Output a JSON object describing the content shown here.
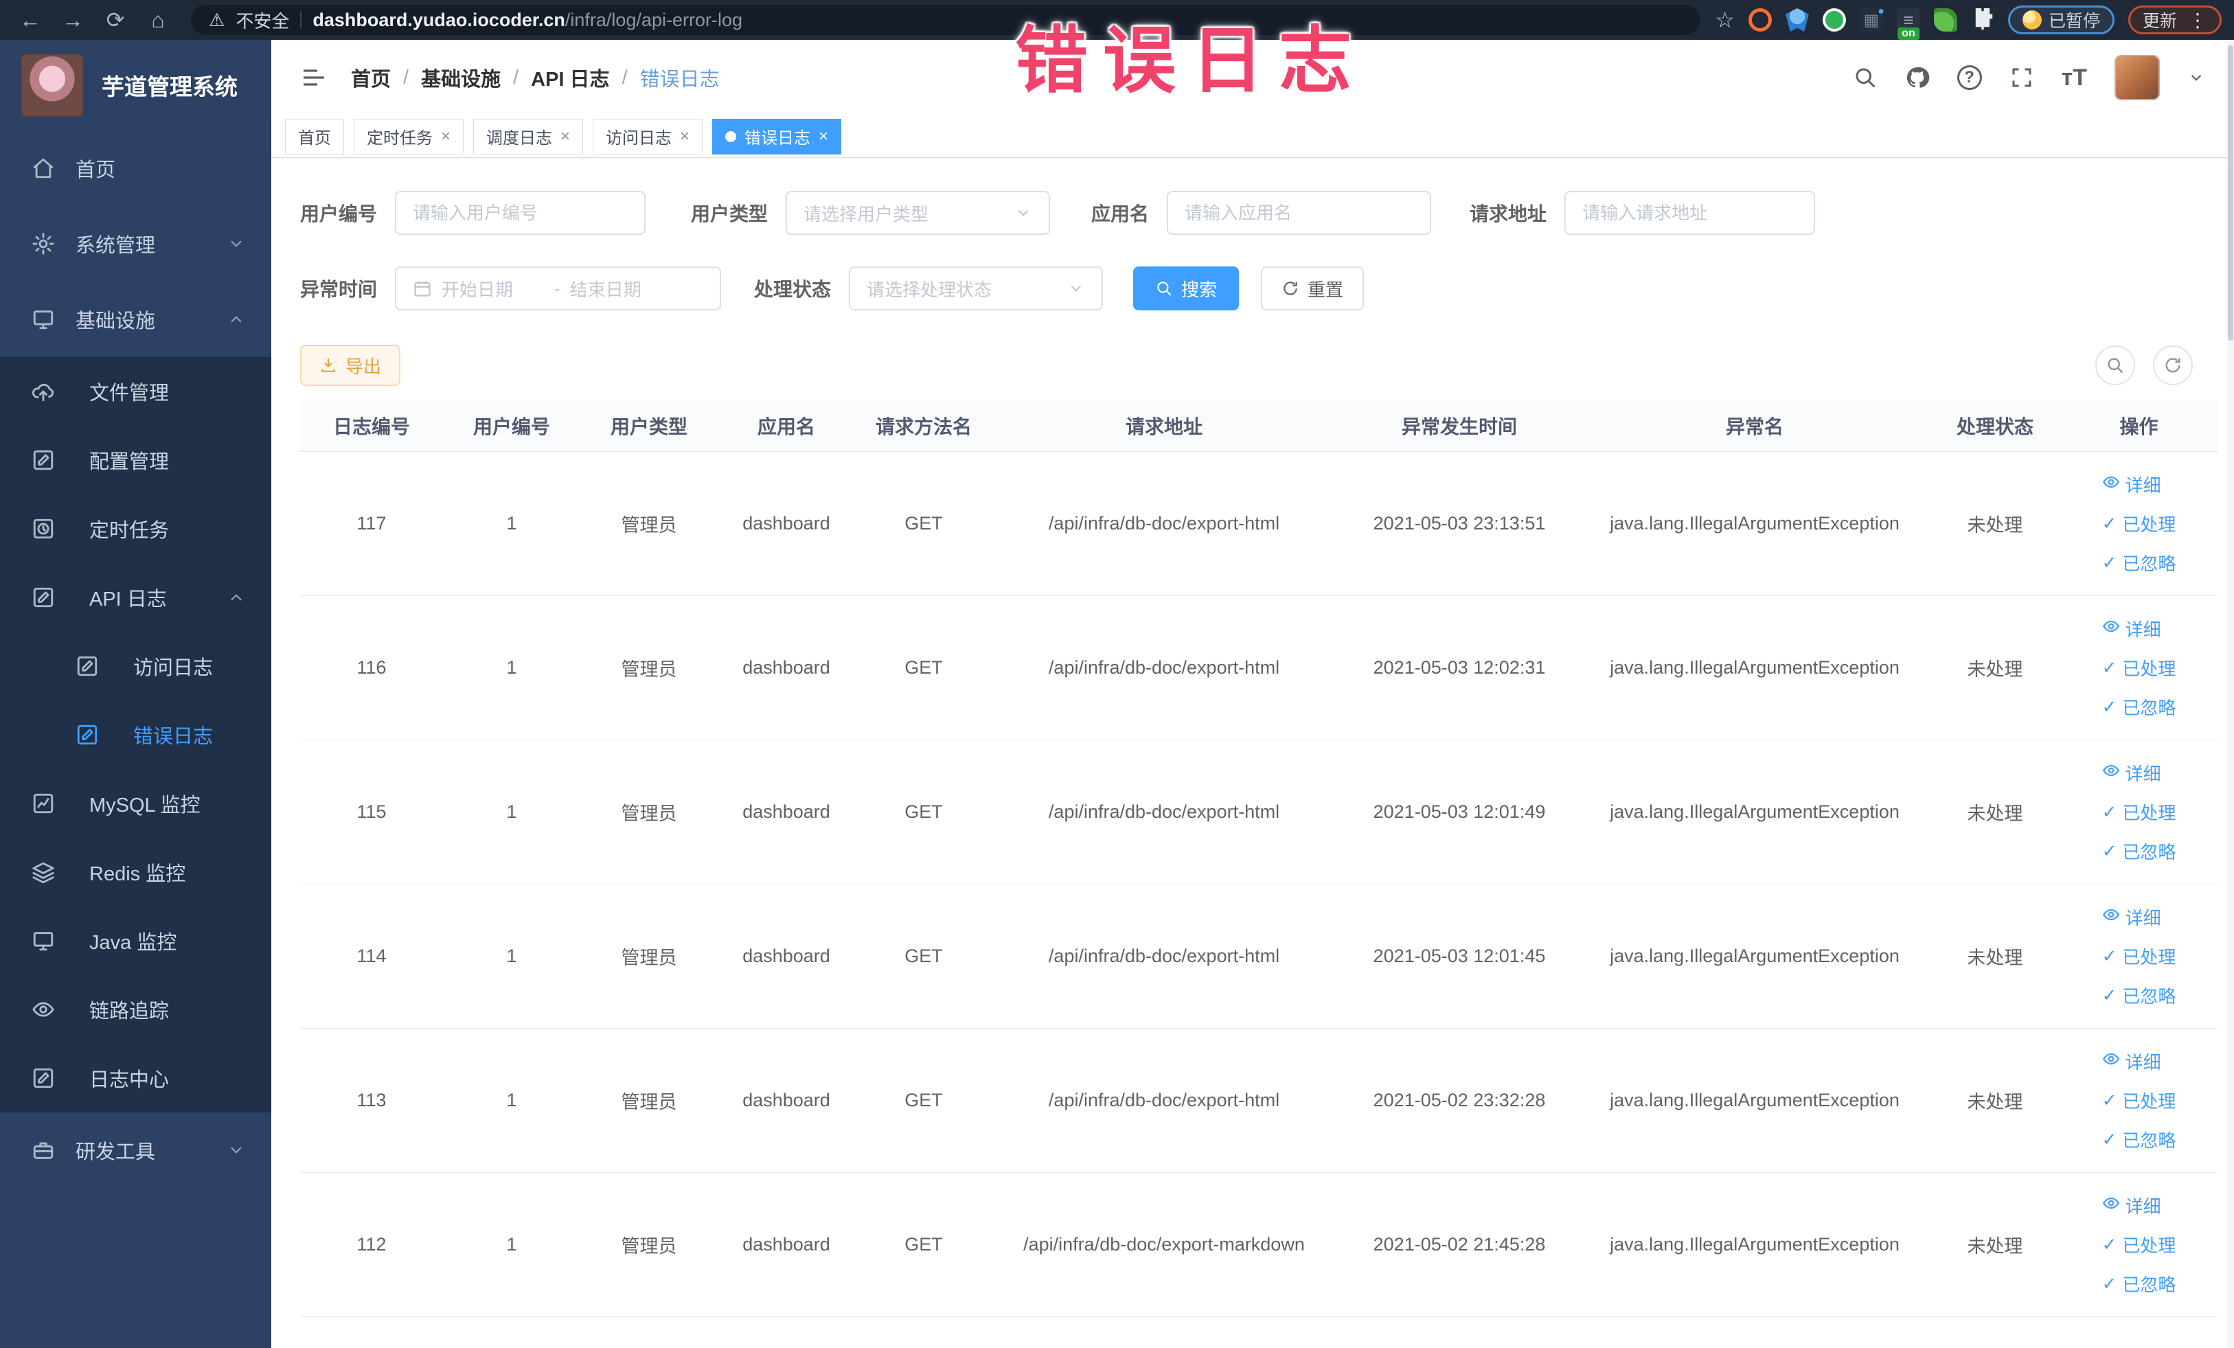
{
  "browser": {
    "security_label": "不安全",
    "url_domain": "dashboard.yudao.iocoder.cn",
    "url_path": "/infra/log/api-error-log",
    "paused_badge": "已暂停",
    "update_label": "更新",
    "extensions": [
      {
        "name": "orange-ring-extension-icon"
      },
      {
        "name": "blue-shield-extension-icon"
      },
      {
        "name": "green-check-extension-icon"
      },
      {
        "name": "grid-extension-icon"
      },
      {
        "name": "on-badge-extension-icon",
        "badge": "on"
      },
      {
        "name": "green-leaf-extension-icon"
      },
      {
        "name": "puzzle-extension-icon"
      }
    ]
  },
  "annotation": {
    "text": "错误日志"
  },
  "sidebar": {
    "title": "芋道管理系统",
    "items": [
      {
        "label": "首页",
        "icon": "home-icon",
        "level": 1
      },
      {
        "label": "系统管理",
        "icon": "gear-icon",
        "level": 1,
        "chevron": "down"
      },
      {
        "label": "基础设施",
        "icon": "monitor-icon",
        "level": 1,
        "chevron": "up"
      },
      {
        "label": "文件管理",
        "icon": "cloud-upload-icon",
        "level": 2,
        "sub": true
      },
      {
        "label": "配置管理",
        "icon": "edit-icon",
        "level": 2,
        "sub": true
      },
      {
        "label": "定时任务",
        "icon": "task-icon",
        "level": 2,
        "sub": true
      },
      {
        "label": "API 日志",
        "icon": "edit-icon",
        "level": 2,
        "sub": true,
        "chevron": "up"
      },
      {
        "label": "访问日志",
        "icon": "edit-icon",
        "level": 3,
        "sub": true
      },
      {
        "label": "错误日志",
        "icon": "edit-icon",
        "level": 3,
        "sub": true,
        "active": true
      },
      {
        "label": "MySQL 监控",
        "icon": "chart-icon",
        "level": 2,
        "sub": true
      },
      {
        "label": "Redis 监控",
        "icon": "layers-icon",
        "level": 2,
        "sub": true
      },
      {
        "label": "Java 监控",
        "icon": "monitor-icon",
        "level": 2,
        "sub": true
      },
      {
        "label": "链路追踪",
        "icon": "eye-icon",
        "level": 2,
        "sub": true
      },
      {
        "label": "日志中心",
        "icon": "edit-icon",
        "level": 2,
        "sub": true
      },
      {
        "label": "研发工具",
        "icon": "toolbox-icon",
        "level": 1,
        "chevron": "down"
      }
    ]
  },
  "breadcrumb": {
    "items": [
      "首页",
      "基础设施",
      "API 日志",
      "错误日志"
    ]
  },
  "tags": [
    {
      "label": "首页",
      "closable": false,
      "active": false
    },
    {
      "label": "定时任务",
      "closable": true,
      "active": false
    },
    {
      "label": "调度日志",
      "closable": true,
      "active": false
    },
    {
      "label": "访问日志",
      "closable": true,
      "active": false
    },
    {
      "label": "错误日志",
      "closable": true,
      "active": true
    }
  ],
  "filters": {
    "user_id": {
      "label": "用户编号",
      "placeholder": "请输入用户编号",
      "value": ""
    },
    "user_type": {
      "label": "用户类型",
      "placeholder": "请选择用户类型"
    },
    "app_name": {
      "label": "应用名",
      "placeholder": "请输入应用名",
      "value": ""
    },
    "request_url": {
      "label": "请求地址",
      "placeholder": "请输入请求地址",
      "value": ""
    },
    "exception_time": {
      "label": "异常时间",
      "start_placeholder": "开始日期",
      "separator": "-",
      "end_placeholder": "结束日期"
    },
    "process_status": {
      "label": "处理状态",
      "placeholder": "请选择处理状态"
    },
    "search_label": "搜索",
    "reset_label": "重置"
  },
  "toolbar": {
    "export_label": "导出"
  },
  "table": {
    "headers": [
      "日志编号",
      "用户编号",
      "用户类型",
      "应用名",
      "请求方法名",
      "请求地址",
      "异常发生时间",
      "异常名",
      "处理状态",
      "操作"
    ],
    "actions": [
      "详细",
      "已处理",
      "已忽略"
    ],
    "rows": [
      [
        "117",
        "1",
        "管理员",
        "dashboard",
        "GET",
        "/api/infra/db-doc/export-html",
        "2021-05-03 23:13:51",
        "java.lang.IllegalArgumentException",
        "未处理"
      ],
      [
        "116",
        "1",
        "管理员",
        "dashboard",
        "GET",
        "/api/infra/db-doc/export-html",
        "2021-05-03 12:02:31",
        "java.lang.IllegalArgumentException",
        "未处理"
      ],
      [
        "115",
        "1",
        "管理员",
        "dashboard",
        "GET",
        "/api/infra/db-doc/export-html",
        "2021-05-03 12:01:49",
        "java.lang.IllegalArgumentException",
        "未处理"
      ],
      [
        "114",
        "1",
        "管理员",
        "dashboard",
        "GET",
        "/api/infra/db-doc/export-html",
        "2021-05-03 12:01:45",
        "java.lang.IllegalArgumentException",
        "未处理"
      ],
      [
        "113",
        "1",
        "管理员",
        "dashboard",
        "GET",
        "/api/infra/db-doc/export-html",
        "2021-05-02 23:32:28",
        "java.lang.IllegalArgumentException",
        "未处理"
      ],
      [
        "112",
        "1",
        "管理员",
        "dashboard",
        "GET",
        "/api/infra/db-doc/export-markdown",
        "2021-05-02 21:45:28",
        "java.lang.IllegalArgumentException",
        "未处理"
      ]
    ]
  },
  "colors": {
    "accent": "#409eff",
    "warning": "#e6a23c",
    "annotation": "#f0436b",
    "sidebar_bg": "#2c4163",
    "submenu_bg": "#1f3048",
    "browser_bar_bg": "#1f2937"
  }
}
